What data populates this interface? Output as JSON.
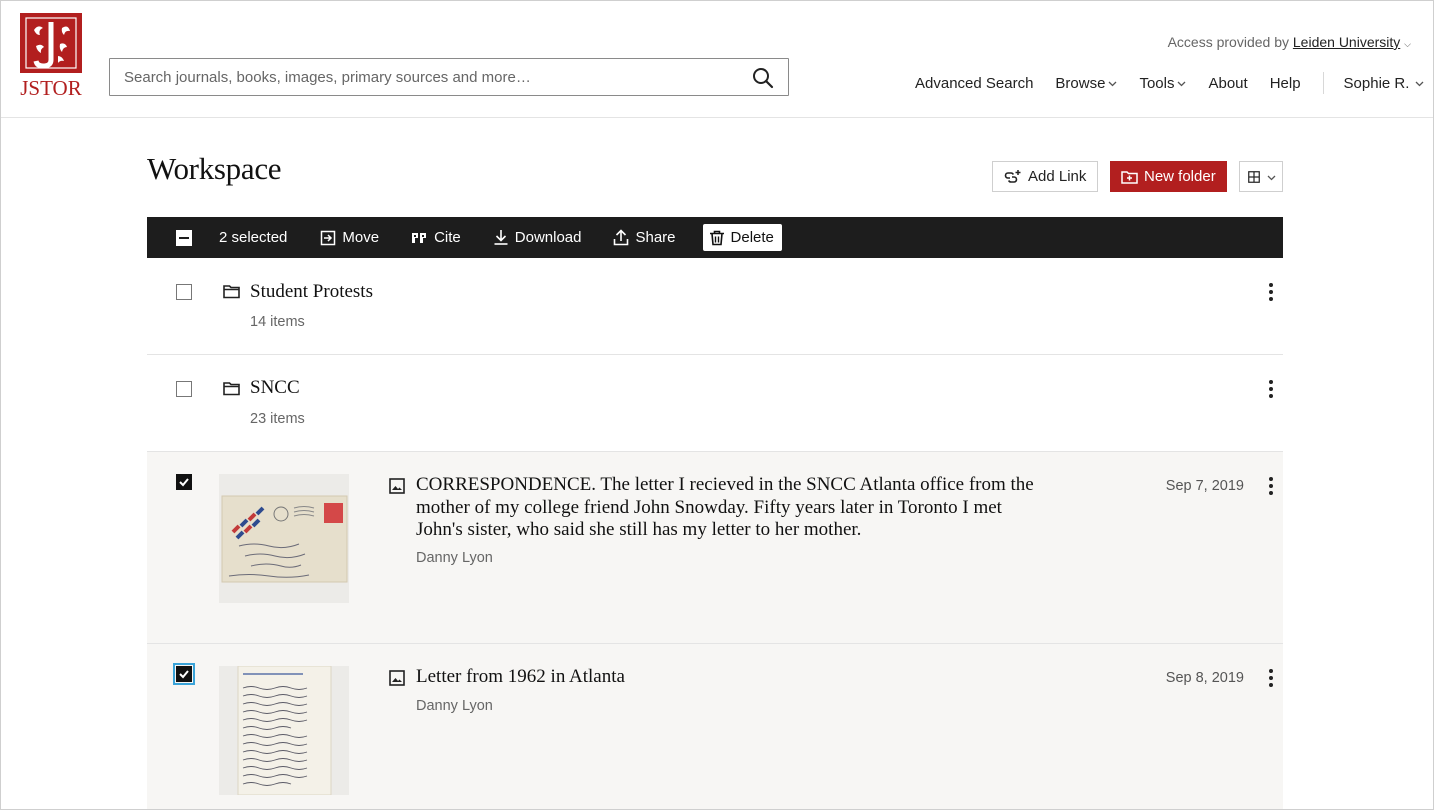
{
  "brand": {
    "logo_text": "JSTOR",
    "color": "#b21f1f"
  },
  "search": {
    "placeholder": "Search journals, books, images, primary sources and more…"
  },
  "access": {
    "prefix": "Access provided by",
    "institution": "Leiden University"
  },
  "nav": {
    "advanced_search": "Advanced Search",
    "browse": "Browse",
    "tools": "Tools",
    "about": "About",
    "help": "Help",
    "user": "Sophie R."
  },
  "workspace": {
    "title": "Workspace",
    "add_link": "Add Link",
    "new_folder": "New folder"
  },
  "toolbar": {
    "selected": "2 selected",
    "move": "Move",
    "cite": "Cite",
    "download": "Download",
    "share": "Share",
    "delete": "Delete"
  },
  "folders": [
    {
      "name": "Student Protests",
      "count": "14 items",
      "checked": false
    },
    {
      "name": "SNCC",
      "count": "23 items",
      "checked": false
    }
  ],
  "items": [
    {
      "title": "CORRESPONDENCE. The letter I recieved in the SNCC Atlanta office from the mother of my college friend John Snowday. Fifty years later in Toronto I met John's sister, who said she still has my letter to her mother.",
      "author": "Danny Lyon",
      "date": "Sep 7, 2019",
      "checked": true,
      "thumbnail": "envelope"
    },
    {
      "title": "Letter from 1962 in Atlanta",
      "author": "Danny Lyon",
      "date": "Sep 8, 2019",
      "checked": true,
      "thumbnail": "handwritten-letter"
    }
  ]
}
